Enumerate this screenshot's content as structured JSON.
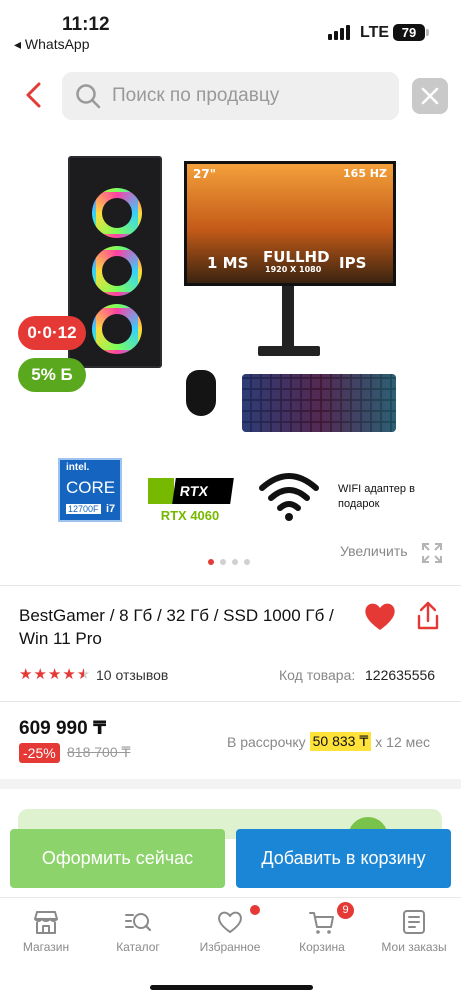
{
  "status_bar": {
    "time": "11:12",
    "back_app": "◂ WhatsApp",
    "network": "LTE",
    "battery": "79"
  },
  "header": {
    "search_placeholder": "Поиск по продавцу"
  },
  "gallery": {
    "badge_installment": "0·0·12",
    "badge_bonus": "5% Б",
    "zoom_label": "Увеличить",
    "slide_count": 4,
    "active_slide": 1,
    "image_text": {
      "monitor_size": "27\"",
      "monitor_hz": "165 HZ",
      "monitor_ms": "1 MS",
      "monitor_fullhd": "FULLHD",
      "monitor_res": "1920 X 1080",
      "monitor_panel": "IPS",
      "intel_brand": "intel.",
      "intel_core": "CORE",
      "intel_model": "12700F",
      "intel_tier": "i7",
      "nvidia_series": "RTX",
      "nvidia_model": "RTX 4060",
      "wifi_caption": "WIFI адаптер в подарок"
    }
  },
  "product": {
    "title": "BestGamer / 8 Гб / 32 Гб /  SSD 1000 Гб / Win 11 Pro",
    "rating": 4.5,
    "reviews": "10 отзывов",
    "code_label": "Код товара:",
    "code_value": "122635556",
    "price": "609 990 ₸",
    "discount": "-25%",
    "old_price": "818 700 ₸",
    "installment_prefix": "В рассрочку",
    "installment_amount": "50 833 ₸",
    "installment_suffix": "x 12 мес"
  },
  "actions": {
    "buy_now": "Оформить сейчас",
    "add_to_cart": "Добавить в корзину"
  },
  "nav": {
    "items": [
      {
        "label": "Магазин"
      },
      {
        "label": "Каталог"
      },
      {
        "label": "Избранное"
      },
      {
        "label": "Корзина"
      },
      {
        "label": "Мои заказы"
      }
    ],
    "cart_count": "9"
  },
  "colors": {
    "accent_red": "#e53935",
    "buy_green": "#8dd36c",
    "cart_blue": "#1c86d6",
    "bonus_green": "#5aa81e",
    "installment_yellow": "#ffe23a"
  }
}
